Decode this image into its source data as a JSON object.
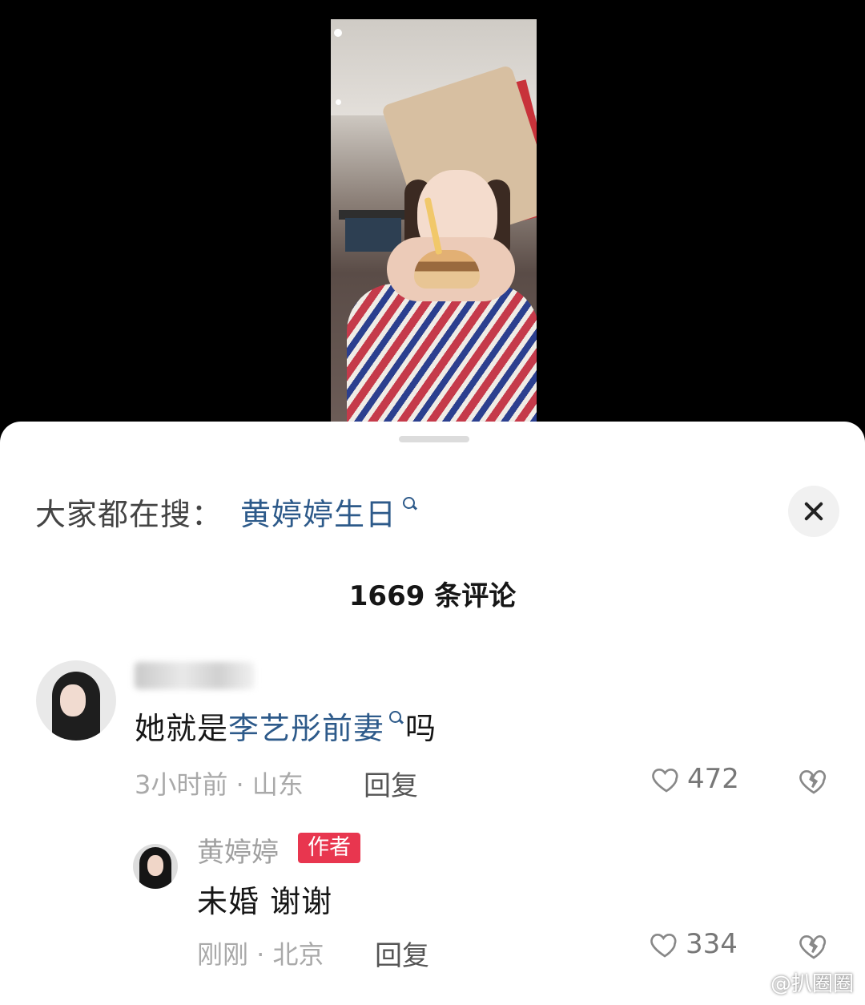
{
  "search_bar": {
    "prefix": "大家都在搜：",
    "term": "黄婷婷生日"
  },
  "comments_header": {
    "count_label": "1669 条评论"
  },
  "comments": [
    {
      "text_plain_before": "她就是",
      "text_link": "李艺彤前妻",
      "text_plain_after": "吗",
      "meta": "3小时前 · 山东",
      "reply_label": "回复",
      "likes": "472"
    }
  ],
  "replies": [
    {
      "username": "黄婷婷",
      "badge": "作者",
      "text": "未婚 谢谢",
      "meta": "刚刚 · 北京",
      "reply_label": "回复",
      "likes": "334"
    }
  ],
  "watermark": {
    "text": "@扒圈圈"
  },
  "colors": {
    "link": "#2d5a8a",
    "badge": "#e8364f"
  }
}
